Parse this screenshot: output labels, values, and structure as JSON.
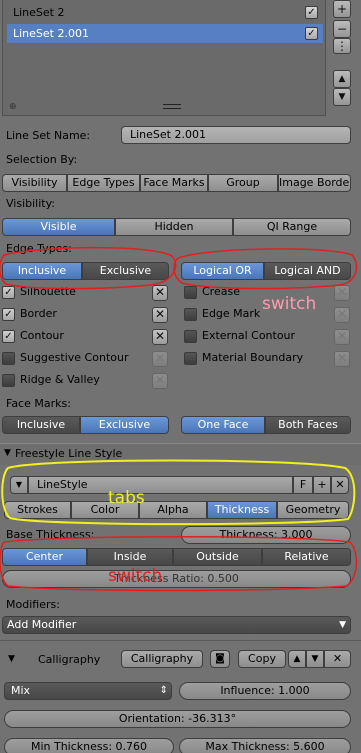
{
  "linesets": {
    "items": [
      {
        "name": "LineSet 2",
        "checked": true,
        "selected": false
      },
      {
        "name": "LineSet 2.001",
        "checked": true,
        "selected": true
      }
    ]
  },
  "side_buttons": {
    "add": "+",
    "remove": "−",
    "down_arrow": "▼",
    "up_arrow": "▲",
    "menu": "⋮"
  },
  "lineset_name": {
    "label": "Line Set Name:",
    "value": "LineSet 2.001"
  },
  "selection_by": {
    "label": "Selection By:",
    "tabs": [
      "Visibility",
      "Edge Types",
      "Face Marks",
      "Group",
      "Image Border"
    ]
  },
  "visibility": {
    "label": "Visibility:",
    "options": [
      "Visible",
      "Hidden",
      "QI Range"
    ],
    "selected": "Visible"
  },
  "edge_types": {
    "label": "Edge Types:",
    "mode_options": [
      "Inclusive",
      "Exclusive"
    ],
    "mode_selected": "Inclusive",
    "logic_options": [
      "Logical OR",
      "Logical AND"
    ],
    "logic_selected": "Logical OR",
    "left_items": [
      {
        "label": "Silhouette",
        "checked": true
      },
      {
        "label": "Border",
        "checked": true
      },
      {
        "label": "Contour",
        "checked": true
      },
      {
        "label": "Suggestive Contour",
        "checked": false
      },
      {
        "label": "Ridge & Valley",
        "checked": false
      }
    ],
    "right_items": [
      {
        "label": "Crease",
        "checked": false
      },
      {
        "label": "Edge Mark",
        "checked": false
      },
      {
        "label": "External Contour",
        "checked": false
      },
      {
        "label": "Material Boundary",
        "checked": false
      }
    ]
  },
  "face_marks": {
    "label": "Face Marks:",
    "mode_options": [
      "Inclusive",
      "Exclusive"
    ],
    "mode_selected": "Exclusive",
    "face_options": [
      "One Face",
      "Both Faces"
    ],
    "face_selected": "One Face"
  },
  "line_style": {
    "panel_title": "Freestyle Line Style",
    "style_name": "LineStyle",
    "fake_user": "F",
    "tabs": [
      "Strokes",
      "Color",
      "Alpha",
      "Thickness",
      "Geometry"
    ],
    "tab_selected": "Thickness"
  },
  "thickness": {
    "base_label": "Base Thickness:",
    "base_value": "Thickness: 3.000",
    "position_options": [
      "Center",
      "Inside",
      "Outside",
      "Relative"
    ],
    "position_selected": "Center",
    "ratio": "Thickness Ratio: 0.500"
  },
  "modifiers": {
    "label": "Modifiers:",
    "add_button": "Add Modifier",
    "calligraphy": {
      "title": "Calligraphy",
      "name_field": "Calligraphy",
      "copy": "Copy",
      "blend": "Mix",
      "influence": "Influence: 1.000",
      "orientation": "Orientation: -36.313°",
      "min_thickness": "Min Thickness: 0.760",
      "max_thickness": "Max Thickness: 5.600"
    }
  },
  "annotations": {
    "switch_1": "switch",
    "tabs": "tabs",
    "switch_2": "switch",
    "color_red": "#e02020",
    "color_yellow": "#f0f020",
    "color_pink": "#ff9ab0"
  }
}
